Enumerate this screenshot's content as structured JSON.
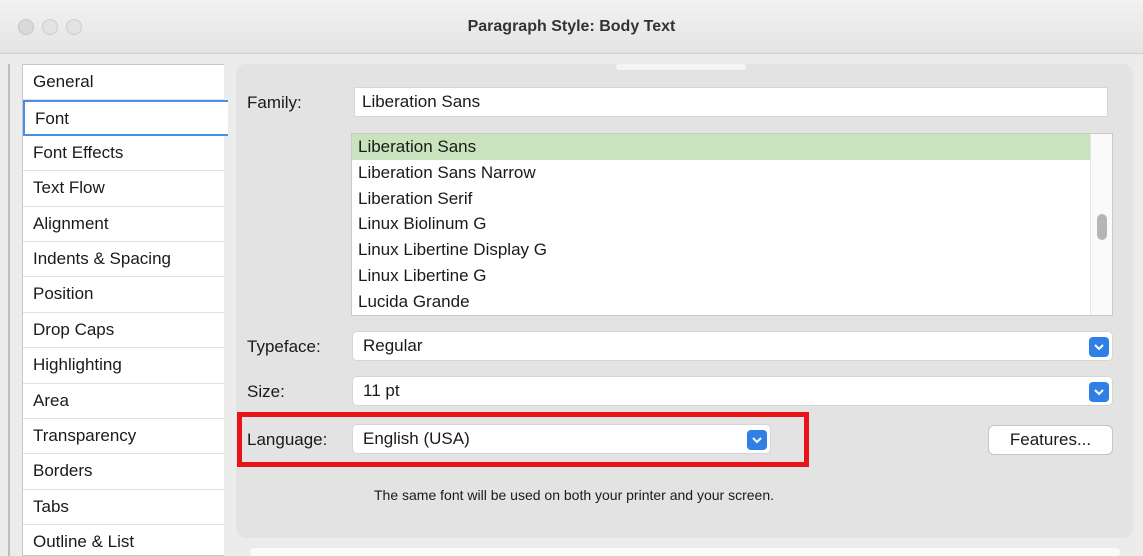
{
  "window": {
    "title": "Paragraph Style: Body Text"
  },
  "sidebar": {
    "items": [
      {
        "label": "General"
      },
      {
        "label": "Font"
      },
      {
        "label": "Font Effects"
      },
      {
        "label": "Text Flow"
      },
      {
        "label": "Alignment"
      },
      {
        "label": "Indents & Spacing"
      },
      {
        "label": "Position"
      },
      {
        "label": "Drop Caps"
      },
      {
        "label": "Highlighting"
      },
      {
        "label": "Area"
      },
      {
        "label": "Transparency"
      },
      {
        "label": "Borders"
      },
      {
        "label": "Tabs"
      },
      {
        "label": "Outline & List"
      }
    ],
    "active": "Font"
  },
  "font": {
    "family_label": "Family:",
    "family_value": "Liberation Sans",
    "list": [
      "Liberation Sans",
      "Liberation Sans Narrow",
      "Liberation Serif",
      "Linux Biolinum G",
      "Linux Libertine Display G",
      "Linux Libertine G",
      "Lucida Grande"
    ],
    "typeface_label": "Typeface:",
    "typeface_value": "Regular",
    "size_label": "Size:",
    "size_value": "11 pt",
    "language_label": "Language:",
    "language_value": "English (USA)",
    "features_label": "Features...",
    "note": "The same font will be used on both your printer and your screen."
  },
  "colors": {
    "selection": "#c8e3bd",
    "accent": "#2f7fe6",
    "highlight_box": "#e8141a",
    "active_tab_border": "#4a8de6"
  }
}
